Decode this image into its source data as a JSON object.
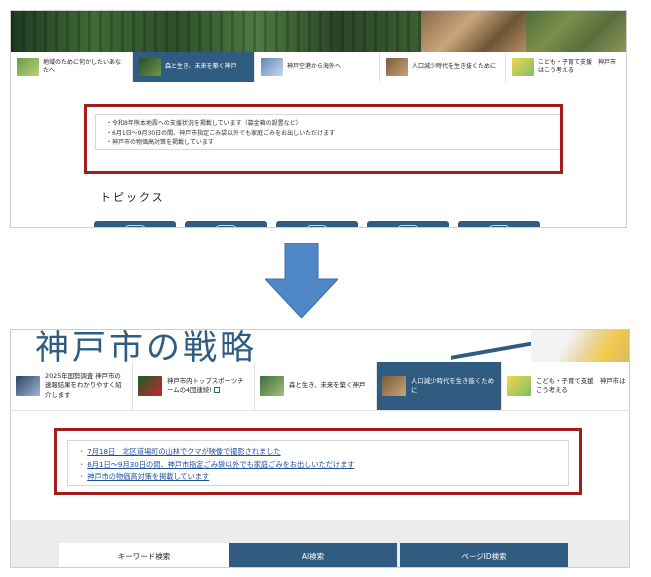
{
  "top_screenshot": {
    "nav_tabs": [
      {
        "label": "地域のために何かしたいあなたへ",
        "active": false
      },
      {
        "label": "森と生き、未来を築く神戸",
        "active": true
      },
      {
        "label": "神戸空港から海外へ",
        "active": false
      },
      {
        "label": "人口減少時代を生き抜くために",
        "active": false
      },
      {
        "label": "こども・子育て支援　神戸市はこう考える",
        "active": false
      }
    ],
    "notices": [
      "・令和8年熊本地震への支援状況を掲載しています（募金箱の設置など）",
      "・6月1日～9月30日の間、神戸市指定ごみ袋以外でも家庭ごみをお出しいただけます",
      "・神戸市の物価高対策を掲載しています"
    ],
    "topics_title": "トピックス"
  },
  "bottom_screenshot": {
    "heading": "神戸市の戦略",
    "nav_tabs": [
      {
        "label": "2025年国勢調査 神戸市の速報結果をわかりやすく紹介します",
        "active": false,
        "thumb_text": "2025年 国勢調査"
      },
      {
        "label": "神戸市内トップスポーツチームの4団連続!",
        "active": false
      },
      {
        "label": "森と生き、未来を築く神戸",
        "active": false
      },
      {
        "label": "人口減少時代を生き抜くために",
        "active": true
      },
      {
        "label": "こども・子育て支援　神戸市はこう考える",
        "active": false
      }
    ],
    "notices": [
      "7月18日　北区道場町の山林でクマが映像で撮影されました",
      "6月1日～9月30日の間、神戸市指定ごみ袋以外でも家庭ごみをお出しいただけます",
      "神戸市の物価高対策を掲載しています"
    ],
    "search_tabs": [
      {
        "label": "キーワード検索",
        "active": true
      },
      {
        "label": "AI検索",
        "active": false
      },
      {
        "label": "ページID検索",
        "active": false
      }
    ]
  },
  "colors": {
    "accent": "#2f5c80",
    "highlight_frame": "#a31d1d",
    "link": "#1f4fa0",
    "arrow_fill": "#4f87c7"
  },
  "icons": [
    "arrow-down-icon",
    "external-link-icon",
    "trash-icon",
    "book-icon"
  ]
}
